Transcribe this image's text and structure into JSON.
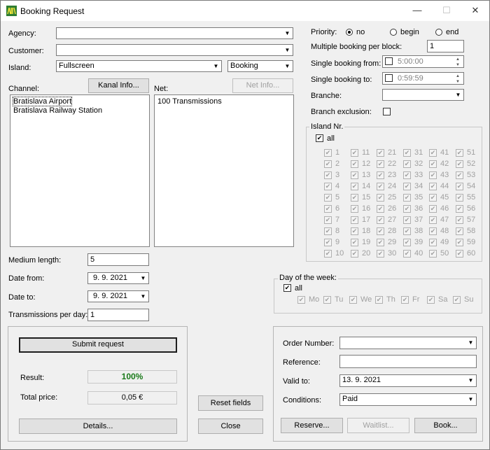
{
  "window": {
    "title": "Booking Request",
    "icon": "app-logo-icon",
    "controls": {
      "minimize": "—",
      "maximize": "☐",
      "close": "✕"
    }
  },
  "form": {
    "agency": {
      "label": "Agency:",
      "value": ""
    },
    "customer": {
      "label": "Customer:",
      "value": ""
    },
    "island": {
      "label": "Island:",
      "value": "Fullscreen",
      "type_value": "Booking"
    },
    "channel": {
      "label": "Channel:",
      "info_button": "Kanal Info...",
      "items": [
        "Bratislava Airport",
        "Bratislava Railway Station"
      ]
    },
    "net": {
      "label": "Net:",
      "info_button": "Net Info...",
      "items": [
        "100 Transmissions"
      ]
    },
    "medium_length": {
      "label": "Medium length:",
      "value": "5"
    },
    "date_from": {
      "label": "Date from:",
      "value": "9. 9. 2021"
    },
    "date_to": {
      "label": "Date to:",
      "value": "9. 9. 2021"
    },
    "transmissions_per_day": {
      "label": "Transmissions per day:",
      "value": "1"
    }
  },
  "right": {
    "priority": {
      "label": "Priority:",
      "options": [
        "no",
        "begin",
        "end"
      ],
      "selected": "no"
    },
    "multiple_booking": {
      "label": "Multiple booking per block:",
      "value": "1"
    },
    "single_from": {
      "label": "Single booking from:",
      "value": "5:00:00"
    },
    "single_to": {
      "label": "Single booking to:",
      "value": "0:59:59"
    },
    "branche": {
      "label": "Branche:",
      "value": ""
    },
    "branch_exclusion": {
      "label": "Branch exclusion:"
    },
    "island_nr": {
      "title": "Island Nr.",
      "all_label": "all",
      "cols": [
        [
          "1",
          "2",
          "3",
          "4",
          "5",
          "6",
          "7",
          "8",
          "9",
          "10"
        ],
        [
          "11",
          "12",
          "13",
          "14",
          "15",
          "16",
          "17",
          "18",
          "19",
          "20"
        ],
        [
          "21",
          "22",
          "23",
          "24",
          "25",
          "26",
          "27",
          "28",
          "29",
          "30"
        ],
        [
          "31",
          "32",
          "33",
          "34",
          "35",
          "36",
          "37",
          "38",
          "39",
          "40"
        ],
        [
          "41",
          "42",
          "43",
          "44",
          "45",
          "46",
          "47",
          "48",
          "49",
          "50"
        ],
        [
          "51",
          "52",
          "53",
          "54",
          "55",
          "56",
          "57",
          "58",
          "59",
          "60"
        ]
      ]
    },
    "day_of_week": {
      "title": "Day of the week:",
      "all_label": "all",
      "days": [
        "Mo",
        "Tu",
        "We",
        "Th",
        "Fr",
        "Sa",
        "Su"
      ]
    }
  },
  "bottom_left": {
    "submit": "Submit request",
    "result_label": "Result:",
    "result_value": "100%",
    "price_label": "Total price:",
    "price_value": "0,05 €",
    "details": "Details..."
  },
  "middle_buttons": {
    "reset": "Reset fields",
    "close": "Close"
  },
  "bottom_right": {
    "order_number": {
      "label": "Order Number:",
      "value": ""
    },
    "reference": {
      "label": "Reference:",
      "value": ""
    },
    "valid_to": {
      "label": "Valid to:",
      "value": "13. 9. 2021"
    },
    "conditions": {
      "label": "Conditions:",
      "value": "Paid"
    },
    "reserve": "Reserve...",
    "waitlist": "Waitlist...",
    "book": "Book..."
  },
  "colors": {
    "result_green": "#1a7a1a"
  }
}
